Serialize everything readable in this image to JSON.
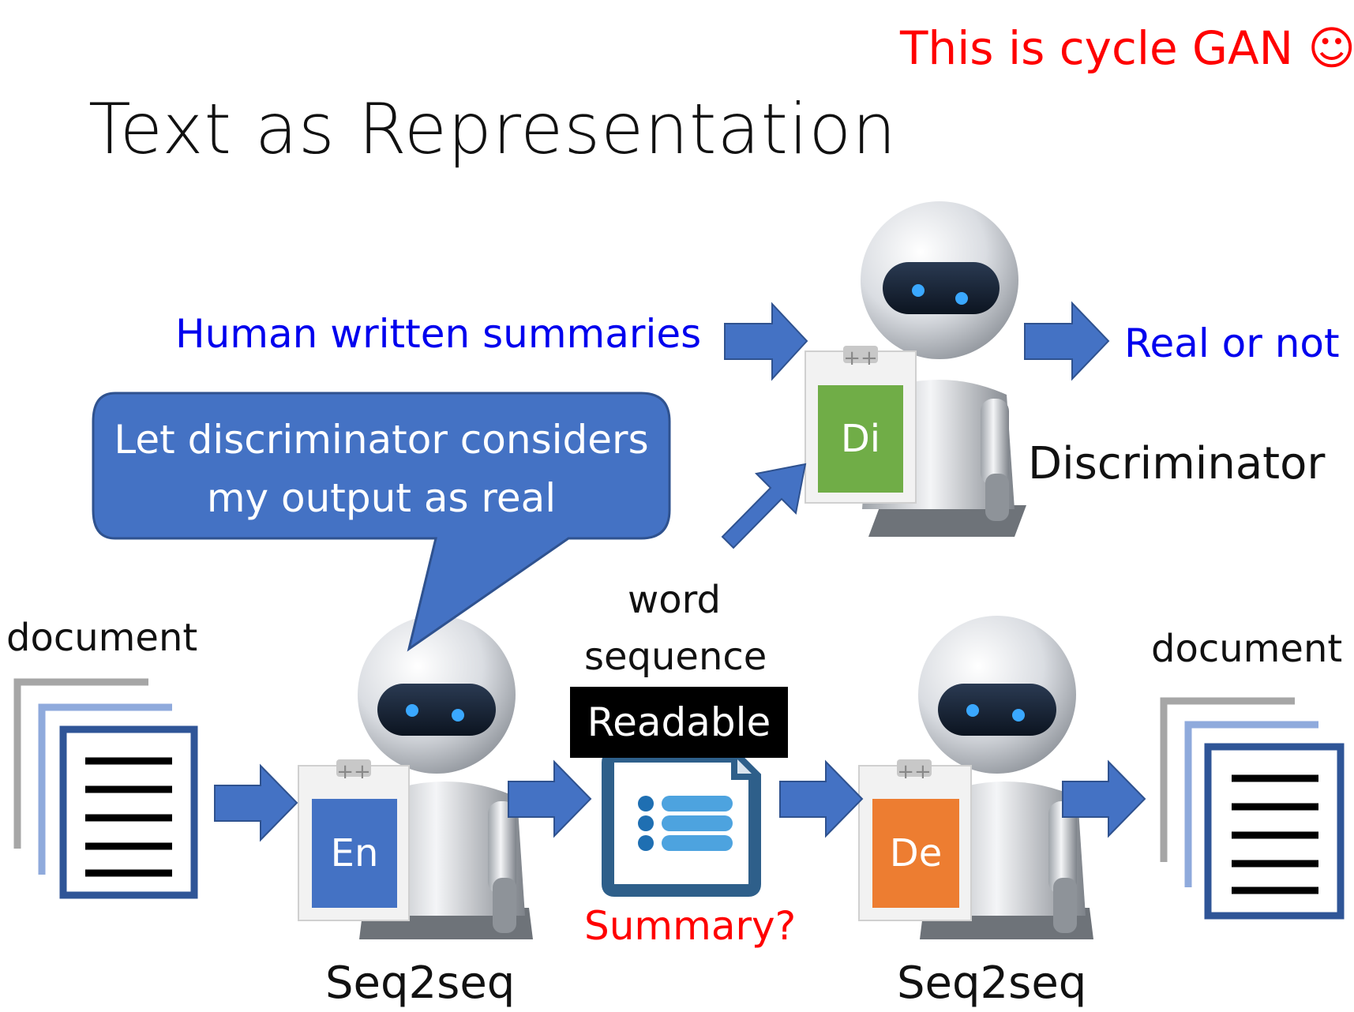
{
  "header": {
    "cycle_note": "This is cycle GAN ☺",
    "title": "Text as Representation"
  },
  "discriminator": {
    "input_label": "Human written summaries",
    "output_label": "Real or not",
    "name": "Discriminator",
    "card_letter": "Di",
    "card_color": "#70ad47"
  },
  "speech_bubble": {
    "line1": "Let discriminator considers",
    "line2": "my output as real",
    "color": "#4472c4"
  },
  "pipeline": {
    "input_doc_label": "document",
    "output_doc_label": "document",
    "middle_line1": "word",
    "middle_line2": "sequence",
    "badge": "Readable",
    "middle_question": "Summary?",
    "encoder": {
      "card_letter": "En",
      "name": "Seq2seq",
      "card_color": "#4472c4"
    },
    "decoder": {
      "card_letter": "De",
      "name": "Seq2seq",
      "card_color": "#ed7d31"
    }
  },
  "colors": {
    "arrow": "#4472c4",
    "label_blue": "#0000ee",
    "label_red": "#ff0000"
  }
}
